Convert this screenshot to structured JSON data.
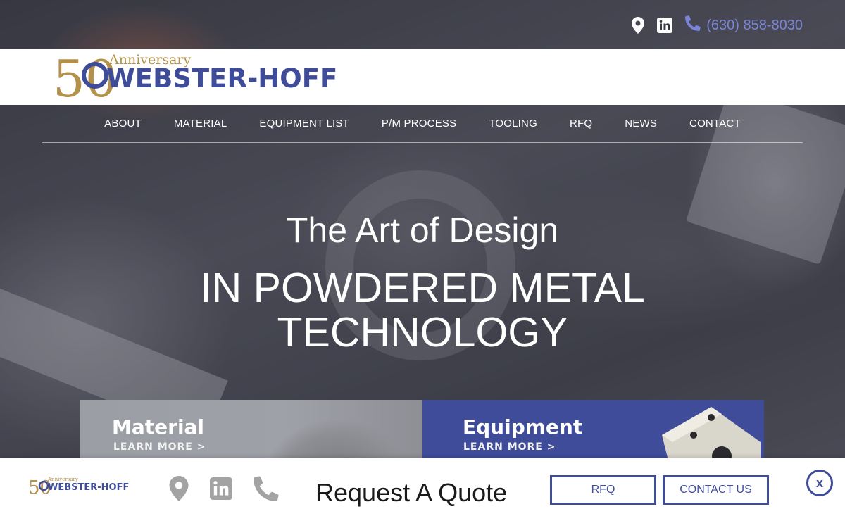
{
  "topbar": {
    "phone": "(630) 858-8030",
    "icons": [
      "map-pin-icon",
      "linkedin-icon",
      "phone-icon"
    ]
  },
  "logo": {
    "anniversary_number": "50",
    "anniversary_text": "Anniversary",
    "brand": "WEBSTER-HOFF"
  },
  "nav": {
    "items": [
      {
        "label": "ABOUT"
      },
      {
        "label": "MATERIAL"
      },
      {
        "label": "EQUIPMENT LIST"
      },
      {
        "label": "P/M PROCESS"
      },
      {
        "label": "TOOLING"
      },
      {
        "label": "RFQ"
      },
      {
        "label": "NEWS"
      },
      {
        "label": "CONTACT"
      }
    ]
  },
  "hero": {
    "title": "The Art of Design",
    "subtitle_line1": "IN POWDERED METAL",
    "subtitle_line2": "TECHNOLOGY"
  },
  "cards": [
    {
      "title": "Material",
      "link": "LEARN MORE >"
    },
    {
      "title": "Equipment",
      "link": "LEARN MORE >"
    }
  ],
  "sticky": {
    "quote_text": "Request A Quote",
    "rfq_label": "RFQ",
    "contact_label": "CONTACT US",
    "close_label": "x"
  },
  "colors": {
    "brand_blue": "#3f4c9a",
    "brand_gold": "#b3914a",
    "phone_link": "#7b84d6"
  }
}
